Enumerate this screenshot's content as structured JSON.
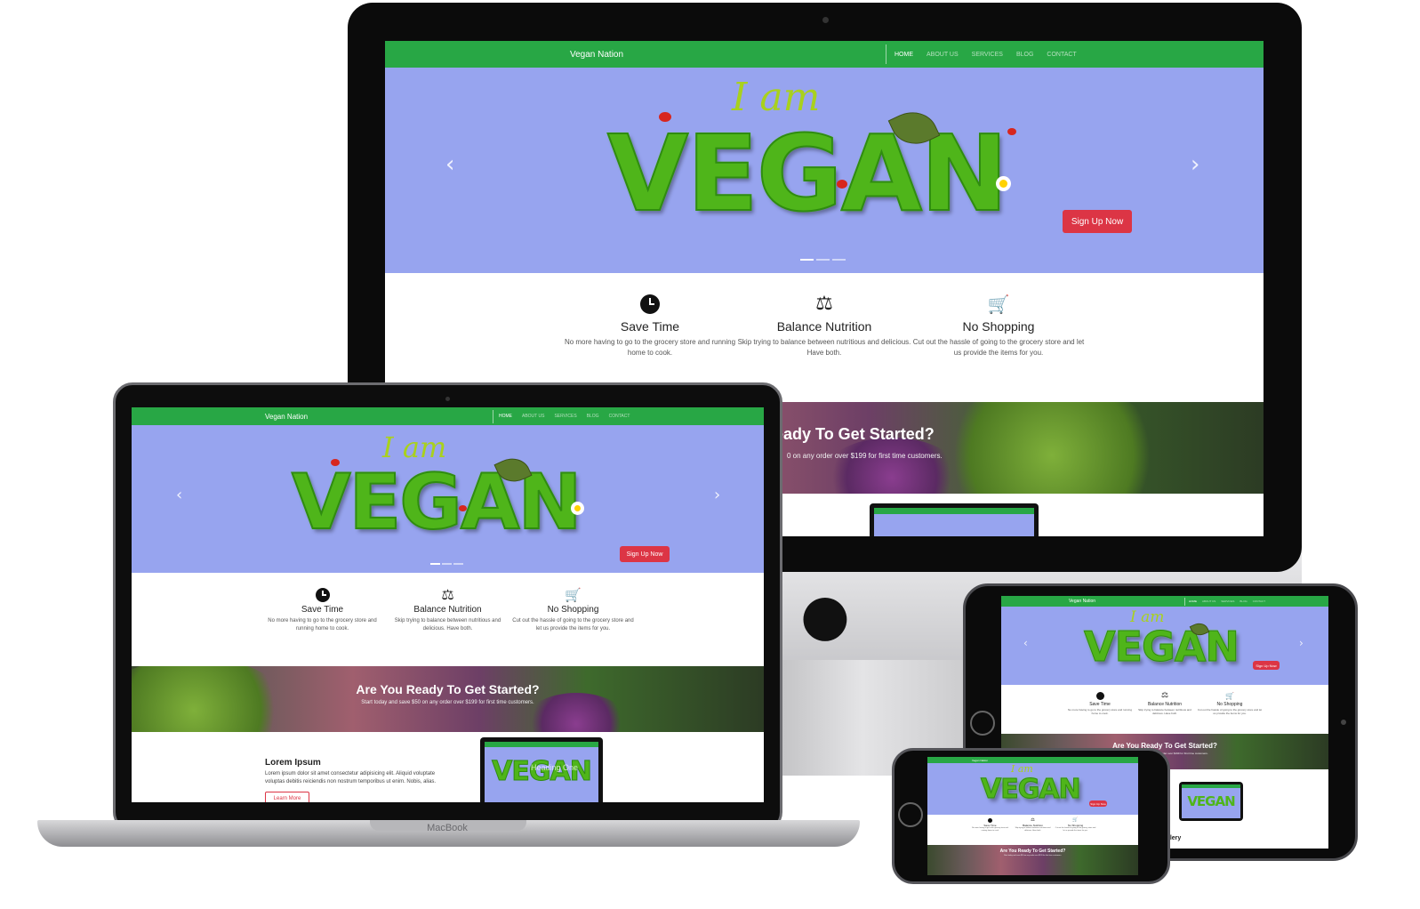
{
  "site": {
    "brand": "Vegan Nation",
    "nav": [
      "HOME",
      "ABOUT US",
      "SERVICES",
      "BLOG",
      "CONTACT"
    ],
    "hero": {
      "iam": "I am",
      "word": "VEGAN",
      "signup": "Sign Up Now",
      "prev_arrow": "‹",
      "next_arrow": "›"
    },
    "features": [
      {
        "icon": "clock-icon",
        "glyph": "🕓",
        "title": "Save Time",
        "desc": "No more having to go to the grocery store and running home to cook."
      },
      {
        "icon": "balance-scale-icon",
        "glyph": "⚖",
        "title": "Balance Nutrition",
        "desc": "Skip trying to balance between nutritious and delicious. Have both."
      },
      {
        "icon": "cart-plus-icon",
        "glyph": "🛒",
        "title": "No Shopping",
        "desc": "Cut out the hassle of going to the grocery store and let us provide the items for you."
      }
    ],
    "cta": {
      "title": "Are You Ready To Get Started?",
      "imac_title_visible": "eady To Get Started?",
      "subtitle": "Start today and save $50 on any order over $199 for first time customers.",
      "imac_subtitle_visible": "0 on any order over $199 for first time customers."
    },
    "about": {
      "title": "Lorem Ipsum",
      "text": "Lorem ipsum dolor sit amet consectetur adipisicing elit. Aliquid voluptate voluptas debitis reiciendis non nostrum temporibus ut enim. Nobis, alias.",
      "button": "Learn More",
      "overlay_caption": "Heading One"
    },
    "gallery_label": "allery"
  },
  "devices": {
    "macbook_label": "MacBook",
    "apple_logo": ""
  },
  "colors": {
    "nav_green": "#28a745",
    "hero_bg": "#97a4ef",
    "signup_red": "#dc3545",
    "grass_green": "#4fb51a",
    "iam_yellow": "#a9d11d"
  }
}
